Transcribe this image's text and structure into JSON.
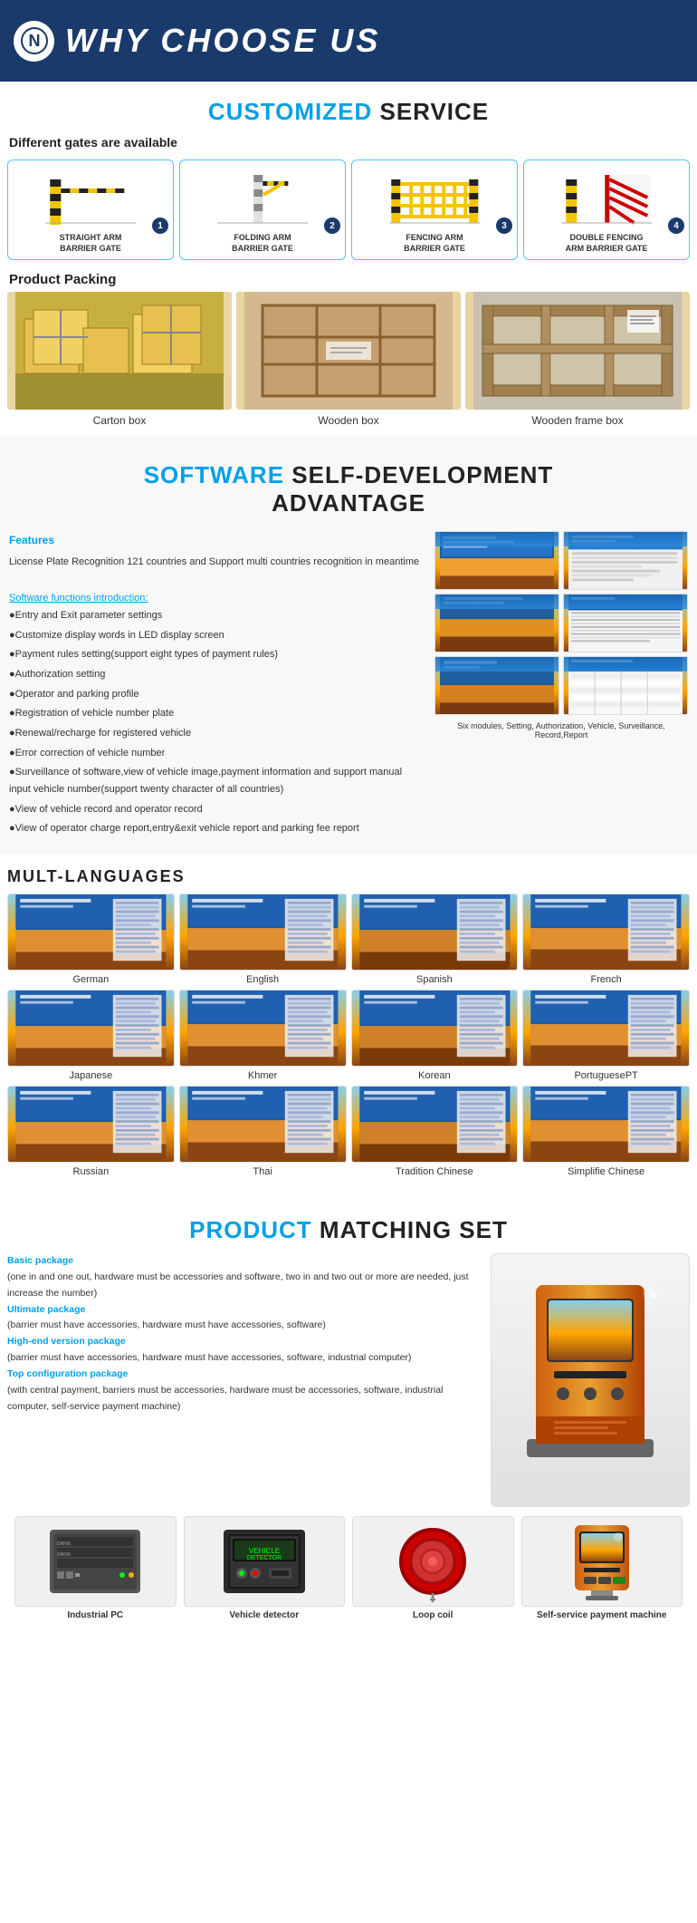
{
  "header": {
    "title": "WHY CHOOSE US",
    "logo_symbol": "N"
  },
  "customized_service": {
    "title_highlight": "CUSTOMIZED",
    "title_normal": " SERVICE",
    "gates_label": "Different gates are available",
    "gates": [
      {
        "num": "1",
        "label": "STRAIGHT ARM\nBARRIER GATE"
      },
      {
        "num": "2",
        "label": "FOLDING ARM\nBARRIER GATE"
      },
      {
        "num": "3",
        "label": "FENCING ARM\nBARRIER GATE"
      },
      {
        "num": "4",
        "label": "DOUBLE FENCING\nARM BARRIER GATE"
      }
    ],
    "packing_label": "Product Packing",
    "packing": [
      {
        "label": "Carton box"
      },
      {
        "label": "Wooden box"
      },
      {
        "label": "Wooden frame box"
      }
    ]
  },
  "software": {
    "title_highlight": "SOFTWARE",
    "title_normal": " SELF-DEVELOPMENT\nADVANTAGE",
    "features_title": "Features",
    "features_text": "License Plate Recognition 121 countries and Support multi countries recognition in meantime",
    "functions_title": "Software functions introduction:",
    "functions": [
      "Entry and Exit parameter settings",
      "Customize display words in LED display screen",
      "Payment rules setting(support eight types of payment rules)",
      "Authorization setting",
      "Operator and parking profile",
      "Registration of vehicle number plate",
      "Renewal/recharge for registered vehicle",
      "Error correction of vehicle number",
      "Surveillance of software,view of vehicle image,payment information and support manual input vehicle number(support twenty character of all countries)",
      "View of vehicle record and operator record",
      "View of operator charge report,entry&exit vehicle report and parking fee report"
    ],
    "screenshot_caption": "Six modules, Setting, Authorization, Vehicle, Surveillance, Record,Report"
  },
  "languages": {
    "title": "MULT-LANGUAGES",
    "items": [
      "German",
      "English",
      "Spanish",
      "French",
      "Japanese",
      "Khmer",
      "Korean",
      "PortuguesePT",
      "Russian",
      "Thai",
      "Tradition Chinese",
      "Simplifie Chinese"
    ]
  },
  "product_matching": {
    "title_highlight": "PRODUCT",
    "title_normal": " MATCHING SET",
    "packages": [
      {
        "title": "Basic package",
        "desc": "(one in and one out, hardware must be accessories and software, two in and two out or more are needed, just increase the number)"
      },
      {
        "title": "Ultimate package",
        "desc": "(barrier must have accessories, hardware must have accessories, software)"
      },
      {
        "title": "High-end version package",
        "desc": "(barrier must have accessories, hardware must have accessories, software, industrial computer)"
      },
      {
        "title": "Top configuration package",
        "desc": "(with central payment, barriers must be accessories, hardware must be accessories, software, industrial computer, self-service payment machine)"
      }
    ],
    "accessories": [
      {
        "name": "Industrial PC"
      },
      {
        "name": "Vehicle detector"
      },
      {
        "name": "Loop coil"
      },
      {
        "name": "Self-service payment machine"
      }
    ]
  }
}
